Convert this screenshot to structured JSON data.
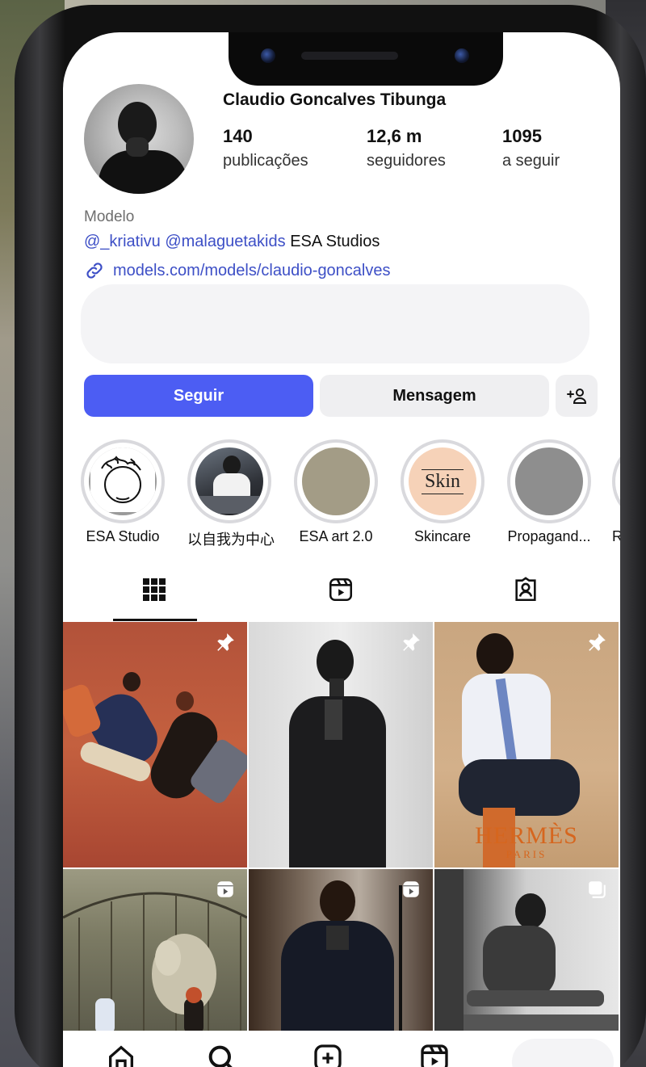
{
  "profile": {
    "username": "Claudio Goncalves Tibunga",
    "stats": [
      {
        "value": "140",
        "label": "publicações"
      },
      {
        "value": "12,6 m",
        "label": "seguidores"
      },
      {
        "value": "1095",
        "label": "a seguir"
      }
    ],
    "category": "Modelo",
    "bio_mention_1": "@_kriativu",
    "bio_mention_2": "@malaguetakids",
    "bio_text": "ESA Studios",
    "link": "models.com/models/claudio-goncalves"
  },
  "buttons": {
    "follow": "Seguir",
    "message": "Mensagem",
    "add_person": "+ዶ"
  },
  "highlights": [
    {
      "name": "ESA Studio"
    },
    {
      "name": "以自我为中心"
    },
    {
      "name": "ESA art 2.0"
    },
    {
      "name": "Skincare",
      "cover_text": "Skin"
    },
    {
      "name": "Propagand..."
    },
    {
      "name": "R"
    }
  ],
  "tabs": [
    {
      "icon": "grid-icon",
      "active": true
    },
    {
      "icon": "reels-icon",
      "active": false
    },
    {
      "icon": "tagged-icon",
      "active": false
    }
  ],
  "posts": [
    {
      "badge": "pin-icon"
    },
    {
      "badge": "pin-icon"
    },
    {
      "badge": "pin-icon",
      "overlay_text": "HERMÈS",
      "overlay_sub": "PARIS"
    },
    {
      "badge": "reel-icon"
    },
    {
      "badge": "reel-icon"
    },
    {
      "badge": "carousel-icon"
    }
  ],
  "bottom_nav": [
    {
      "icon": "home-icon"
    },
    {
      "icon": "search-icon"
    },
    {
      "icon": "create-icon"
    },
    {
      "icon": "reels-icon"
    }
  ],
  "colors": {
    "accent_blue": "#4c5df3",
    "link_blue": "#3d4fc6"
  }
}
